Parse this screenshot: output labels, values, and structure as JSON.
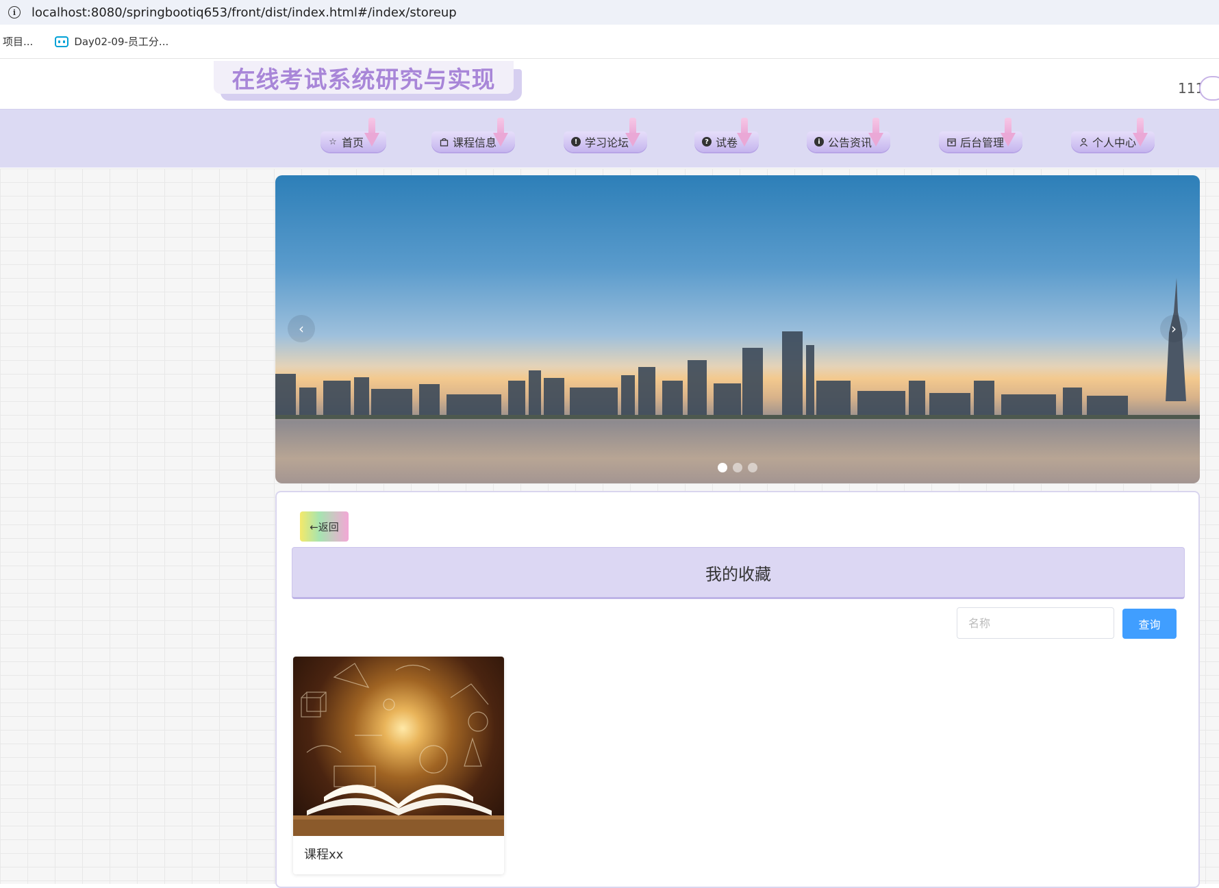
{
  "browser": {
    "url": "localhost:8080/springbootiq653/front/dist/index.html#/index/storeup",
    "bookmarks": [
      {
        "label": "项目...",
        "icon": ""
      },
      {
        "label": "Day02-09-员工分...",
        "icon": "bilibili-icon"
      }
    ]
  },
  "header": {
    "site_title": "在线考试系统研究与实现",
    "username": "111"
  },
  "nav": {
    "items": [
      {
        "label": "首页",
        "icon": "star-icon"
      },
      {
        "label": "课程信息",
        "icon": "bag-icon"
      },
      {
        "label": "学习论坛",
        "icon": "alert-icon"
      },
      {
        "label": "试卷",
        "icon": "question-icon"
      },
      {
        "label": "公告资讯",
        "icon": "info-icon"
      },
      {
        "label": "后台管理",
        "icon": "box-icon"
      },
      {
        "label": "个人中心",
        "icon": "user-icon"
      }
    ]
  },
  "banner": {
    "prev_glyph": "‹",
    "next_glyph": "›",
    "indicator_count": 3,
    "active_index": 0
  },
  "main": {
    "back_label": "←返回",
    "section_title": "我的收藏",
    "search": {
      "placeholder": "名称",
      "value": "",
      "button_label": "查询"
    },
    "favorites": [
      {
        "title": "课程xx",
        "image": "open-book-with-math-formulas"
      }
    ]
  },
  "colors": {
    "nav_bg": "#dcdaf3",
    "title_purple": "#a886d8",
    "search_button": "#409eff",
    "section_head_bg": "#dcd7f3"
  }
}
